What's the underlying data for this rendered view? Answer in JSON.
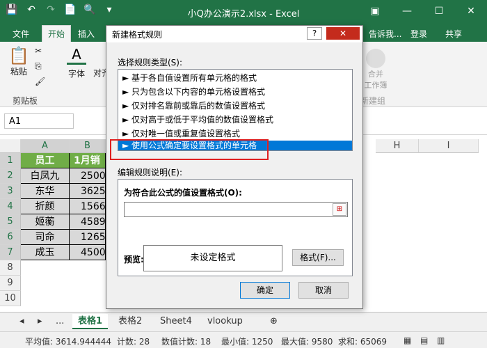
{
  "app": {
    "title": "小Q办公演示2.xlsx - Excel",
    "brand_color": "#217346"
  },
  "ribbon_tabs": {
    "file": "文件",
    "home": "开始",
    "insert": "插入",
    "tell": "告诉我...",
    "login": "登录",
    "share": "共享"
  },
  "ribbon": {
    "paste": "粘贴",
    "font": "字体",
    "align": "对齐",
    "merge": "合并\n工作簿",
    "merge_label": "合并\n工作簿",
    "clipboard_group": "剪贴板",
    "new_group": "新建组",
    "font_icon": "A"
  },
  "name_box": "A1",
  "grid": {
    "columns": [
      "A",
      "B",
      "H",
      "I"
    ],
    "rows": [
      "1",
      "2",
      "3",
      "4",
      "5",
      "6",
      "7",
      "8",
      "9",
      "10"
    ],
    "header_row": [
      "员工",
      "1月销"
    ],
    "data": [
      [
        "白凤九",
        "2500"
      ],
      [
        "东华",
        "3625"
      ],
      [
        "折颜",
        "1566"
      ],
      [
        "姬蘅",
        "4589"
      ],
      [
        "司命",
        "1265"
      ],
      [
        "成玉",
        "4500"
      ]
    ]
  },
  "sheet_tabs": [
    "表格1",
    "表格2",
    "Sheet4",
    "vlookup"
  ],
  "sheet_more": "...",
  "status": {
    "average": "平均值: 3614.944444",
    "count": "计数: 28",
    "numcount": "数值计数: 18",
    "min": "最小值: 1250",
    "max": "最大值: 9580",
    "sum": "求和: 65069"
  },
  "dialog": {
    "title": "新建格式规则",
    "help": "?",
    "close": "✕",
    "select_rule_type": "选择规则类型(S):",
    "rule_types": [
      "► 基于各自值设置所有单元格的格式",
      "► 只为包含以下内容的单元格设置格式",
      "► 仅对排名靠前或靠后的数值设置格式",
      "► 仅对高于或低于平均值的数值设置格式",
      "► 仅对唯一值或重复值设置格式",
      "► 使用公式确定要设置格式的单元格"
    ],
    "selected_index": 5,
    "edit_description": "编辑规则说明(E):",
    "formula_label": "为符合此公式的值设置格式(O):",
    "formula_value": "",
    "preview_label": "预览:",
    "preview_text": "未设定格式",
    "format_button": "格式(F)...",
    "ok_button": "确定",
    "cancel_button": "取消"
  }
}
